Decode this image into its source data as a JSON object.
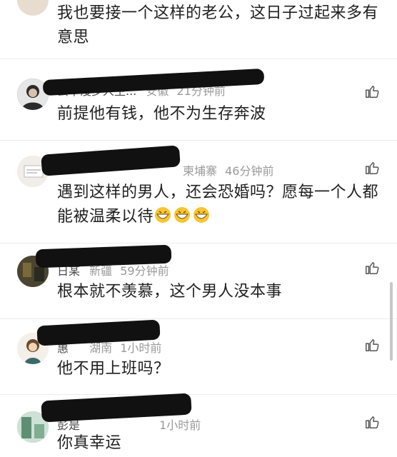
{
  "comments": [
    {
      "name": "",
      "location": "",
      "time": "",
      "text": "我也要接一个这样的老公，这日子过起来多有意思"
    },
    {
      "name": "云中漫步人生...",
      "location": "安徽",
      "time": "21分钟前",
      "text": "前提他有钱，他不为生存奔波"
    },
    {
      "name": "",
      "location": "柬埔寨",
      "time": "46分钟前",
      "text": "遇到这样的男人，还会恐婚吗？愿每一个人都能被温柔以待"
    },
    {
      "name": "日某",
      "location": "新疆",
      "time": "59分钟前",
      "text": "根本就不羡慕，这个男人没本事"
    },
    {
      "name": "惠",
      "location": "湖南",
      "time": "1小时前",
      "text": "他不用上班吗？"
    },
    {
      "name": "彭是",
      "location": "",
      "time": "1小时前",
      "text": "你真幸运"
    }
  ],
  "icons": {
    "like": "thumbs-up-icon",
    "emoji": "grin-emoji-icon"
  }
}
